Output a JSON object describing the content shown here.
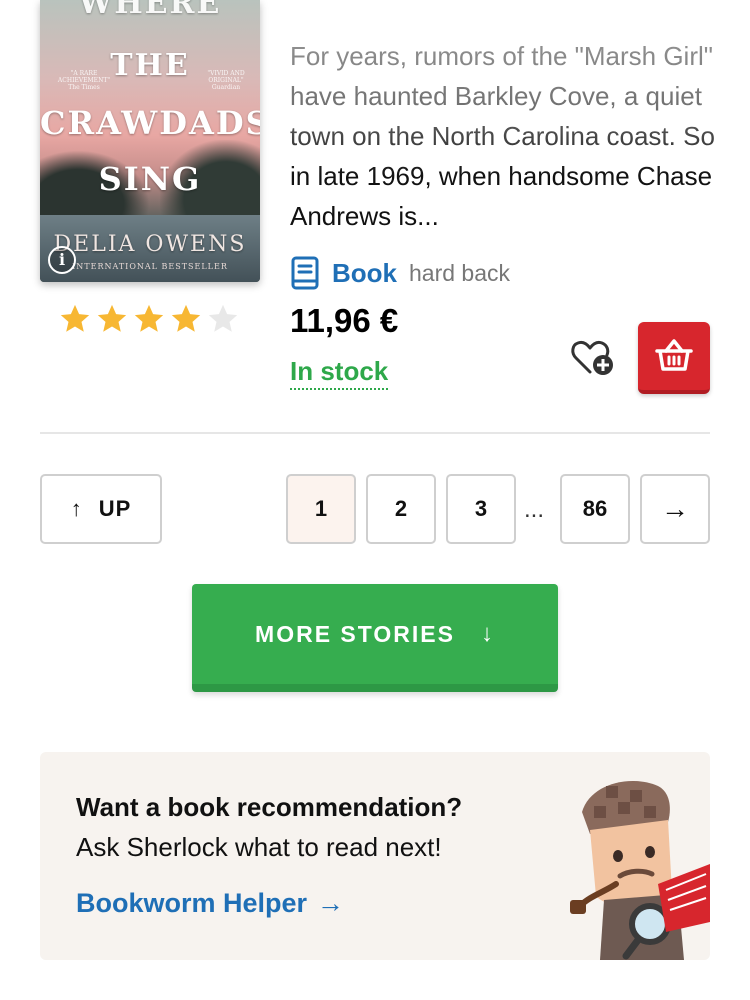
{
  "product": {
    "cover": {
      "title_lines": [
        "WHERE",
        "THE",
        "CRAWDADS",
        "SING"
      ],
      "quote_left": "\"A RARE ACHIEVEMENT\" The Times",
      "quote_right": "\"VIVID AND ORIGINAL\" Guardian",
      "author": "DELIA OWENS",
      "tagline": "INTERNATIONAL BESTSELLER"
    },
    "info_icon": "i",
    "rating": 4,
    "rating_max": 5,
    "description": "For years, rumors of the \"Marsh Girl\" have haunted Barkley Cove, a quiet  town on the North Carolina coast. So in late 1969, when handsome Chase Andrews is...",
    "format": {
      "name": "Book",
      "detail": "hard back",
      "icon": "book-icon"
    },
    "price": "11,96 €",
    "stock": "In stock",
    "colors": {
      "link_blue": "#1f6fb6",
      "stock_green": "#2ea84a",
      "cart_red": "#d7262d",
      "star": "#f7b733"
    }
  },
  "pagination": {
    "up_label": "UP",
    "pages": [
      "1",
      "2",
      "3",
      "86"
    ],
    "active_page": "1",
    "ellipsis": "...",
    "next_arrow": "→"
  },
  "more_stories": {
    "label": "MORE STORIES",
    "arrow": "↓"
  },
  "recommendation": {
    "title": "Want a book recommendation?",
    "subtitle": "Ask Sherlock what to read next!",
    "link": "Bookworm Helper",
    "link_arrow": "→"
  }
}
